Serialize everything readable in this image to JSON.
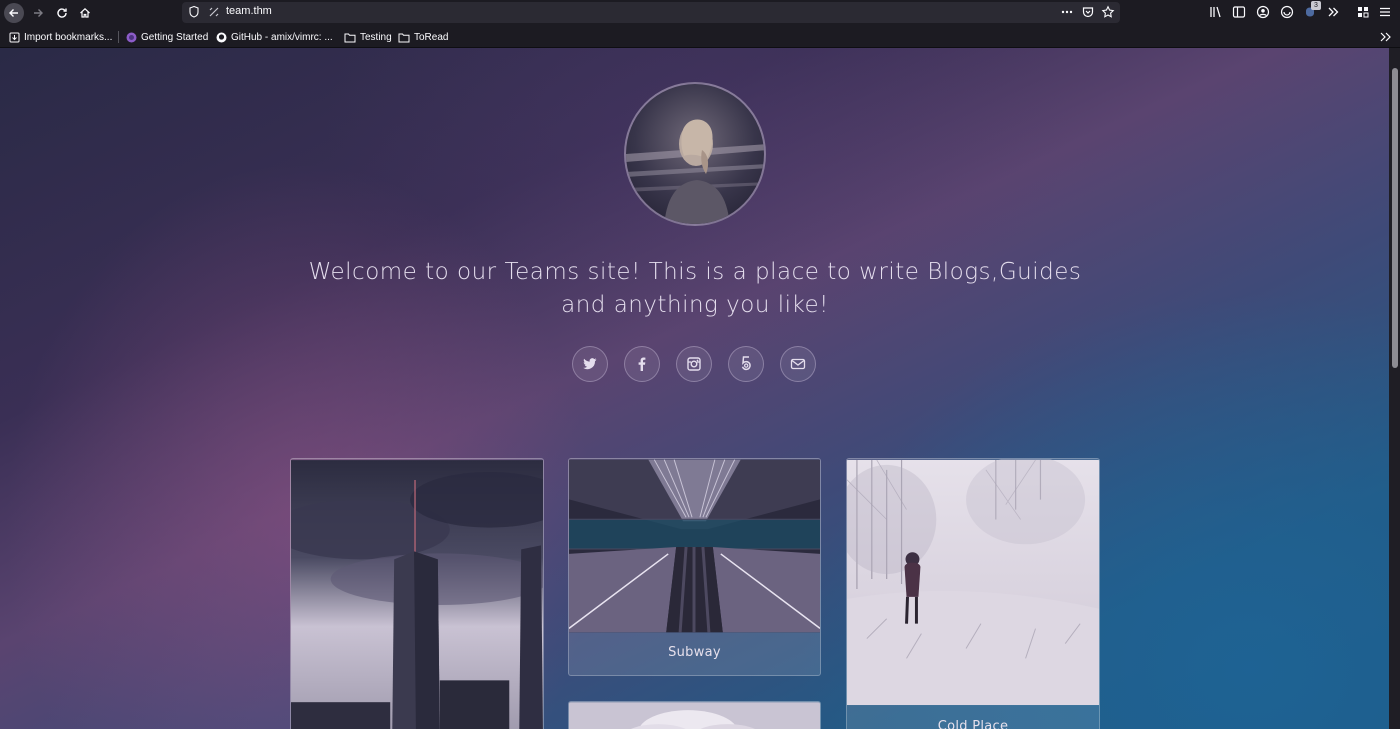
{
  "browser": {
    "url": "team.thm",
    "extension_badge": "3",
    "bookmarks": [
      {
        "label": "Import bookmarks...",
        "icon": "import-icon"
      },
      {
        "label": "Getting Started",
        "icon": "firefox-icon"
      },
      {
        "label": "GitHub - amix/vimrc: ...",
        "icon": "github-icon"
      },
      {
        "label": "Testing",
        "icon": "folder-icon"
      },
      {
        "label": "ToRead",
        "icon": "folder-icon"
      }
    ]
  },
  "hero": {
    "welcome_text": "Welcome to our Teams site! This is a place to write Blogs,Guides and anything you like!",
    "social_links": [
      {
        "icon": "twitter-icon"
      },
      {
        "icon": "facebook-icon"
      },
      {
        "icon": "instagram-icon"
      },
      {
        "icon": "500px-icon"
      },
      {
        "icon": "email-icon"
      }
    ]
  },
  "gallery": {
    "cards": [
      {
        "caption": "",
        "image": "skyscraper"
      },
      {
        "caption": "Subway",
        "image": "escalator"
      },
      {
        "caption": "Cold Place",
        "image": "snowy-field"
      },
      {
        "caption": "",
        "image": "clouds"
      }
    ]
  },
  "colors": {
    "chrome_bg": "#1c1b22",
    "urlbar_bg": "#2b2a33",
    "text_light": "#e4dded"
  }
}
